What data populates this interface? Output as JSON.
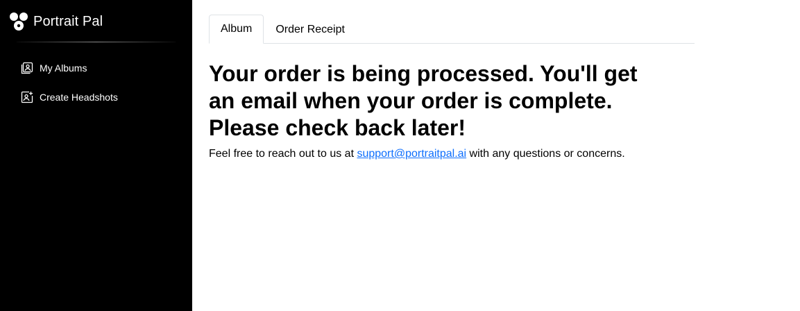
{
  "brand": {
    "name": "Portrait Pal",
    "logo_icon": "portrait-pal-logo-icon"
  },
  "sidebar": {
    "items": [
      {
        "label": "My Albums",
        "icon": "album-icon"
      },
      {
        "label": "Create Headshots",
        "icon": "add-image-icon"
      }
    ]
  },
  "tabs": [
    {
      "label": "Album",
      "active": true
    },
    {
      "label": "Order Receipt",
      "active": false
    }
  ],
  "main": {
    "heading": "Your order is being processed. You'll get an email when your order is complete. Please check back later!",
    "note_prefix": "Feel free to reach out to us at ",
    "support_email": "support@portraitpal.ai",
    "note_suffix": " with any questions or concerns."
  },
  "colors": {
    "sidebar_bg": "#000000",
    "link": "#0d6efd",
    "tab_border": "#dee2e6"
  }
}
